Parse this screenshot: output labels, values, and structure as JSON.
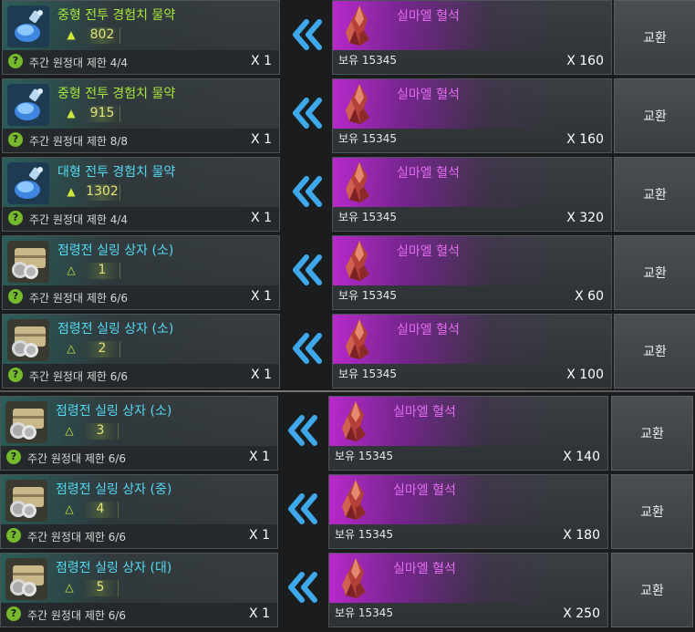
{
  "rows": [
    {
      "item_name": "중형 전투 경험치 물약",
      "name_color": "green",
      "item_icon": "potion-icon",
      "stat_icon": "helmet-icon",
      "stat_value": "802",
      "limit": "주간 원정대 제한 4/4",
      "qty": "X 1",
      "cost_name": "실마엘 혈석",
      "owned": "보유 15345",
      "cost_qty": "X 160",
      "button": "교환"
    },
    {
      "item_name": "중형 전투 경험치 물약",
      "name_color": "green",
      "item_icon": "potion-icon",
      "stat_icon": "helmet-icon",
      "stat_value": "915",
      "limit": "주간 원정대 제한 8/8",
      "qty": "X 1",
      "cost_name": "실마엘 혈석",
      "owned": "보유 15345",
      "cost_qty": "X 160",
      "button": "교환"
    },
    {
      "item_name": "대형 전투 경험치 물약",
      "name_color": "blue",
      "item_icon": "potion-icon",
      "stat_icon": "helmet-icon",
      "stat_value": "1302",
      "limit": "주간 원정대 제한 4/4",
      "qty": "X 1",
      "cost_name": "실마엘 혈석",
      "owned": "보유 15345",
      "cost_qty": "X 320",
      "button": "교환"
    },
    {
      "item_name": "점령전 실링 상자 (소)",
      "name_color": "blue",
      "item_icon": "chest-icon",
      "stat_icon": "flask-icon",
      "stat_value": "1",
      "limit": "주간 원정대 제한 6/6",
      "qty": "X 1",
      "cost_name": "실마엘 혈석",
      "owned": "보유 15345",
      "cost_qty": "X 60",
      "button": "교환"
    },
    {
      "item_name": "점령전 실링 상자 (소)",
      "name_color": "blue",
      "item_icon": "chest-icon",
      "stat_icon": "flask-icon",
      "stat_value": "2",
      "limit": "주간 원정대 제한 6/6",
      "qty": "X 1",
      "cost_name": "실마엘 혈석",
      "owned": "보유 15345",
      "cost_qty": "X 100",
      "button": "교환"
    },
    {
      "item_name": "점령전 실링 상자 (소)",
      "name_color": "blue",
      "item_icon": "chest-icon",
      "stat_icon": "flask-icon",
      "stat_value": "3",
      "limit": "주간 원정대 제한 6/6",
      "qty": "X 1",
      "cost_name": "실마엘 혈석",
      "owned": "보유 15345",
      "cost_qty": "X 140",
      "button": "교환"
    },
    {
      "item_name": "점령전 실링 상자 (중)",
      "name_color": "blue",
      "item_icon": "chest-icon",
      "stat_icon": "flask-icon",
      "stat_value": "4",
      "limit": "주간 원정대 제한 6/6",
      "qty": "X 1",
      "cost_name": "실마엘 혈석",
      "owned": "보유 15345",
      "cost_qty": "X 180",
      "button": "교환"
    },
    {
      "item_name": "점령전 실링 상자 (대)",
      "name_color": "blue",
      "item_icon": "chest-icon",
      "stat_icon": "flask-icon",
      "stat_value": "5",
      "limit": "주간 원정대 제한 6/6",
      "qty": "X 1",
      "cost_name": "실마엘 혈석",
      "owned": "보유 15345",
      "cost_qty": "X 250",
      "button": "교환"
    }
  ],
  "help_glyph": "?",
  "colors": {
    "item_name_blue": "#53d9f2",
    "item_name_green": "#a6e83a",
    "cost_name": "#e46cf2",
    "help_icon": "#75ba2d",
    "arrow": "#3ea8e8"
  }
}
